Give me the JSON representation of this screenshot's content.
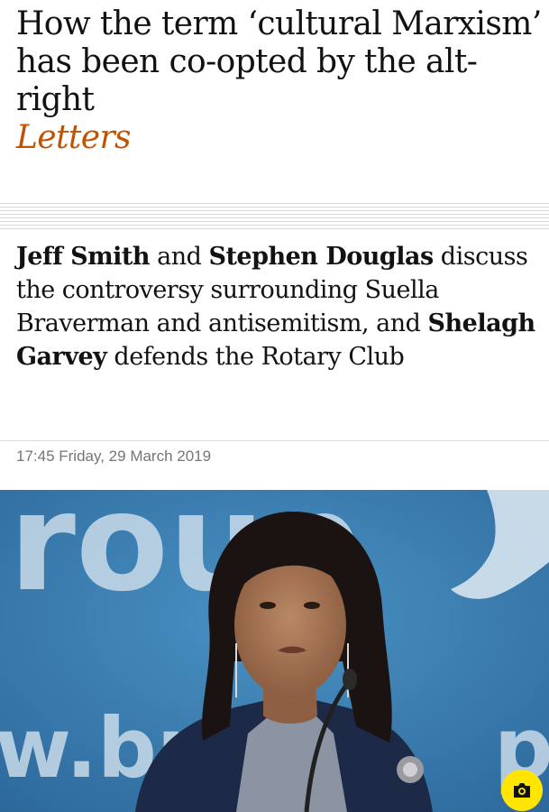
{
  "article": {
    "headline": "How the term ‘cultural Marxism’ has been co-opted by the alt-right",
    "series": "Letters",
    "standfirst": {
      "author1": "Jeff Smith",
      "and1": " and ",
      "author2": "Stephen Douglas",
      "text1": " discuss the controversy surrounding Suella Braverman and antisemitism, and ",
      "author3": "Shelagh Garvey",
      "text2": " defends the Rotary Club"
    },
    "dateline": "17:45 Friday, 29 March 2019"
  },
  "photo": {
    "backdrop_text_top": "roup",
    "backdrop_text_bottom": "w.br",
    "backdrop_text_right": "p"
  },
  "colors": {
    "series_accent": "#c05303",
    "camera_button": "#ffe500",
    "backdrop_blue": "#3a7fb0"
  },
  "icons": {
    "camera": "camera-icon"
  }
}
